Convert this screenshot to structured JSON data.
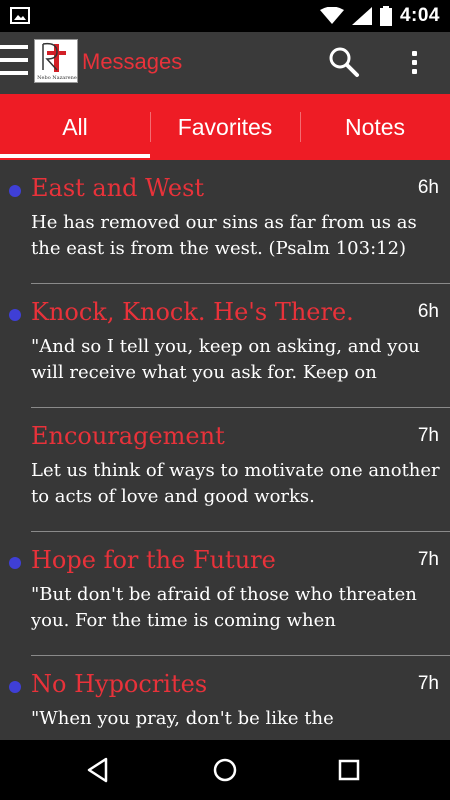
{
  "status_bar": {
    "time": "4:04"
  },
  "app_bar": {
    "title": "Messages",
    "logo_caption": "Nebo Nazarene",
    "icons": [
      "menu-icon",
      "app-logo",
      "search-icon",
      "more-vert-icon"
    ]
  },
  "tabs": [
    {
      "label": "All",
      "active": true
    },
    {
      "label": "Favorites",
      "active": false
    },
    {
      "label": "Notes",
      "active": false
    }
  ],
  "messages": [
    {
      "title": "East and West",
      "time": "6h",
      "unread": true,
      "body": "He has removed our sins as far from us as the east is from the west. (Psalm 103:12)"
    },
    {
      "title": "Knock, Knock. He's There.",
      "time": "6h",
      "unread": true,
      "body": "\"And so I tell you, keep on asking, and you will receive what you ask for. Keep on"
    },
    {
      "title": "Encouragement",
      "time": "7h",
      "unread": false,
      "body": "Let us think of ways to motivate one another to acts of love and good works."
    },
    {
      "title": "Hope for the Future",
      "time": "7h",
      "unread": true,
      "body": "\"But don't be afraid of those who threaten you. For the time is coming when"
    },
    {
      "title": "No Hypocrites",
      "time": "7h",
      "unread": true,
      "body": "\"When you pray, don't be like the"
    }
  ],
  "colors": {
    "accent": "#ee1c25",
    "title_red": "#e8323a",
    "app_bar": "#3a3a3a",
    "list_bg": "#373737",
    "unread_dot": "#3f3fd6"
  },
  "nav_bar": {
    "icons": [
      "back-icon",
      "home-icon",
      "recents-icon"
    ]
  }
}
